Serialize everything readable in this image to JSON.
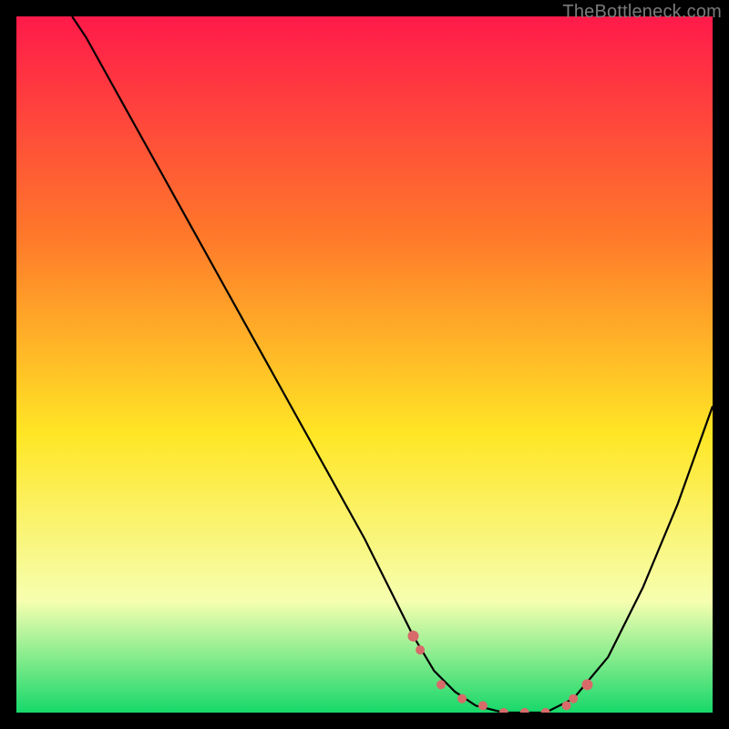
{
  "watermark": "TheBottleneck.com",
  "colors": {
    "bg": "#000000",
    "curve": "#000000",
    "dots": "#d86a6a",
    "gradient_top": "#ff1a4a",
    "gradient_mid1": "#ff7a2a",
    "gradient_mid2": "#ffe625",
    "gradient_mid3": "#f6ffb0",
    "gradient_bottom": "#17d86a"
  },
  "chart_data": {
    "type": "line",
    "title": "",
    "xlabel": "",
    "ylabel": "",
    "xlim": [
      0,
      100
    ],
    "ylim": [
      0,
      100
    ],
    "series": [
      {
        "name": "bottleneck-curve",
        "x": [
          8,
          10,
          15,
          20,
          25,
          30,
          35,
          40,
          45,
          50,
          55,
          57,
          60,
          63,
          66,
          70,
          73,
          76,
          80,
          85,
          90,
          95,
          100
        ],
        "values": [
          100,
          97,
          88,
          79,
          70,
          61,
          52,
          43,
          34,
          25,
          15,
          11,
          6,
          3,
          1,
          0,
          0,
          0,
          2,
          8,
          18,
          30,
          44
        ]
      }
    ],
    "highlight_points": {
      "name": "optimal-zone-dots",
      "x": [
        57,
        58,
        61,
        64,
        67,
        70,
        73,
        76,
        79,
        80,
        82
      ],
      "values": [
        11,
        9,
        4,
        2,
        1,
        0,
        0,
        0,
        1,
        2,
        4
      ]
    }
  }
}
